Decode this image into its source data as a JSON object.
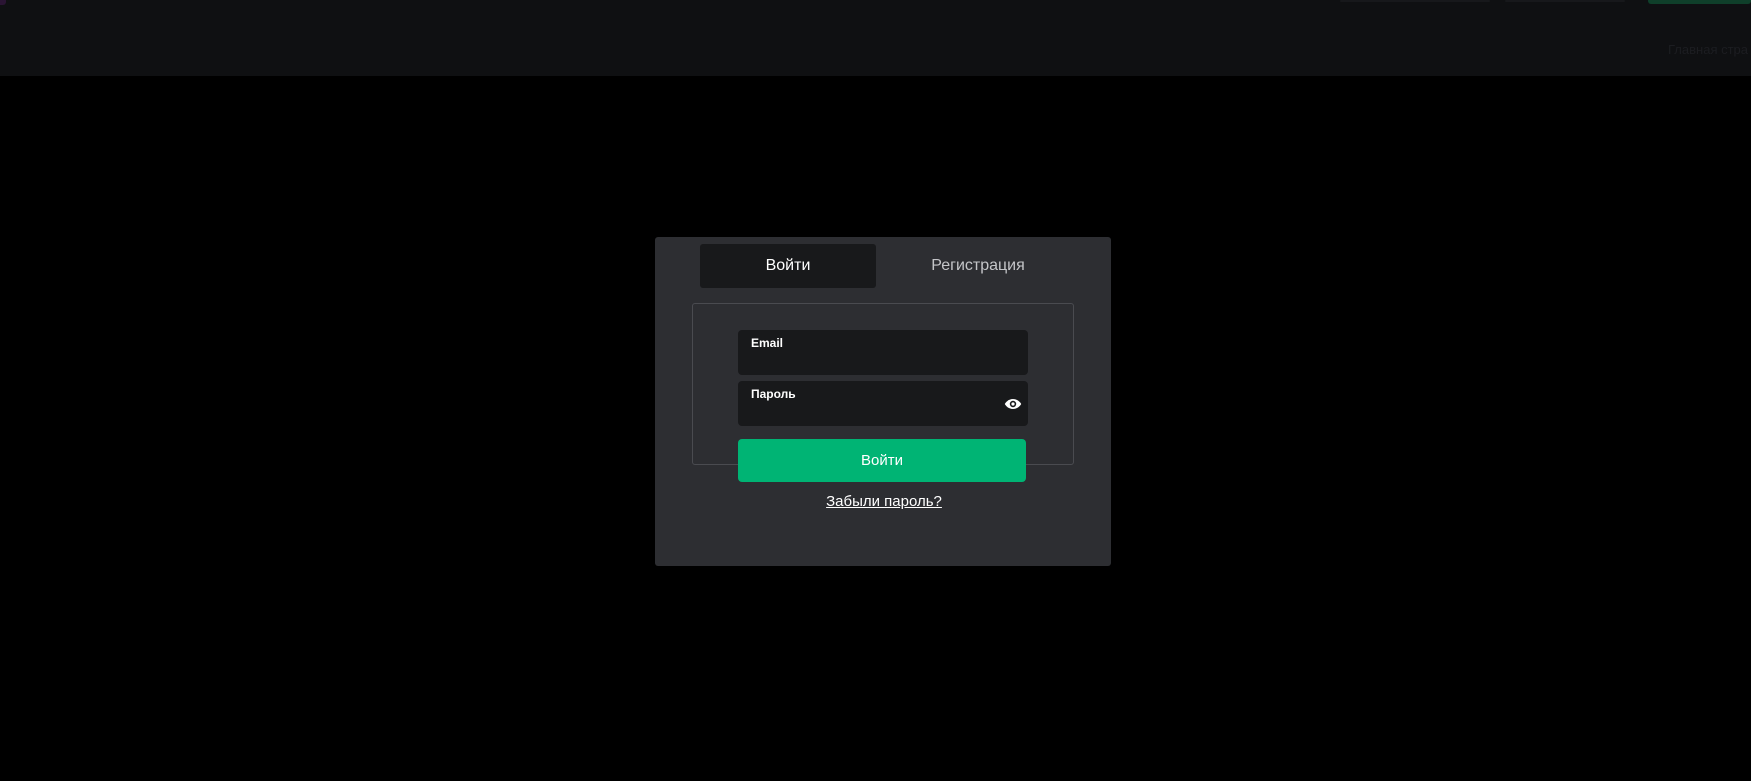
{
  "background": {
    "page_color": "#000000",
    "header_color": "#0f1012",
    "header_faint_text": "Главная стра"
  },
  "modal": {
    "background_color": "#2d2e32",
    "tabs": [
      {
        "label": "Войти",
        "active": true
      },
      {
        "label": "Регистрация",
        "active": false
      }
    ],
    "email_field": {
      "label": "Email",
      "value": ""
    },
    "password_field": {
      "label": "Пароль",
      "value": "",
      "toggle_icon": "eye-icon"
    },
    "submit_label": "Войти",
    "submit_color": "#00b474",
    "forgot_password_label": "Забыли пароль?"
  }
}
